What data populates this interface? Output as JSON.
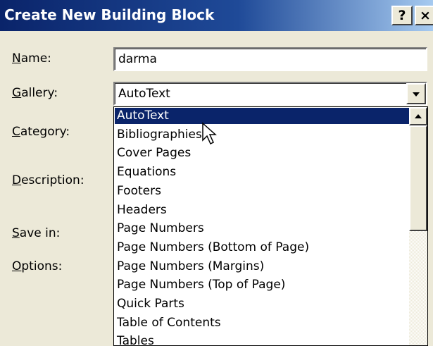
{
  "window": {
    "title": "Create New Building Block",
    "help_button": "?",
    "close_button": "×"
  },
  "form": {
    "name": {
      "label_accel": "N",
      "label_rest": "ame:",
      "value": "darma"
    },
    "gallery": {
      "label_accel": "G",
      "label_rest": "allery:",
      "value": "AutoText"
    },
    "category": {
      "label_accel": "C",
      "label_rest": "ategory:"
    },
    "description": {
      "label_accel": "D",
      "label_rest": "escription:"
    },
    "save_in": {
      "label_accel": "S",
      "label_rest": "ave in:"
    },
    "options": {
      "label_accel": "O",
      "label_rest": "ptions:"
    }
  },
  "gallery_dropdown": {
    "selected_index": 0,
    "items": [
      "AutoText",
      "Bibliographies",
      "Cover Pages",
      "Equations",
      "Footers",
      "Headers",
      "Page Numbers",
      "Page Numbers (Bottom of Page)",
      "Page Numbers (Margins)",
      "Page Numbers (Top of Page)",
      "Quick Parts",
      "Table of Contents",
      "Tables"
    ]
  },
  "colors": {
    "selection": "#0A246A",
    "dialog_face": "#ECE9D8"
  }
}
